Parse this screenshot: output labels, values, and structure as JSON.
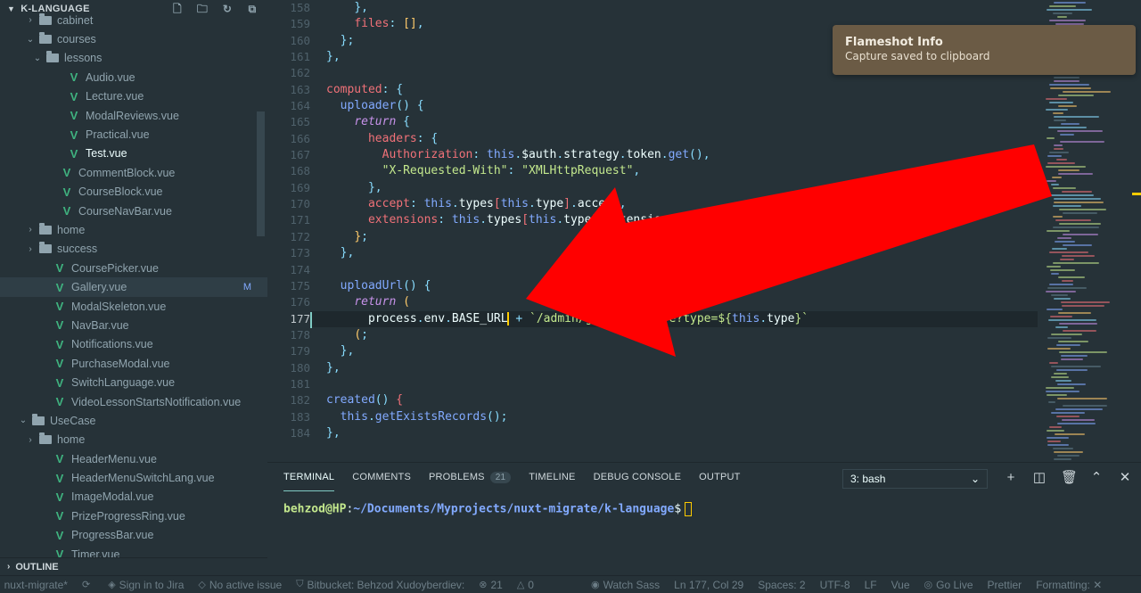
{
  "explorer": {
    "title": "K-LANGUAGE",
    "outline_label": "OUTLINE",
    "items": [
      {
        "label": "cabinet",
        "indent": 44,
        "type": "folder",
        "open": false
      },
      {
        "label": "courses",
        "indent": 44,
        "type": "folder",
        "open": true
      },
      {
        "label": "lessons",
        "indent": 52,
        "type": "folder",
        "open": true
      },
      {
        "label": "Audio.vue",
        "indent": 76,
        "type": "vue"
      },
      {
        "label": "Lecture.vue",
        "indent": 76,
        "type": "vue"
      },
      {
        "label": "ModalReviews.vue",
        "indent": 76,
        "type": "vue"
      },
      {
        "label": "Practical.vue",
        "indent": 76,
        "type": "vue"
      },
      {
        "label": "Test.vue",
        "indent": 76,
        "type": "vue",
        "active": true
      },
      {
        "label": "CommentBlock.vue",
        "indent": 68,
        "type": "vue"
      },
      {
        "label": "CourseBlock.vue",
        "indent": 68,
        "type": "vue"
      },
      {
        "label": "CourseNavBar.vue",
        "indent": 68,
        "type": "vue"
      },
      {
        "label": "home",
        "indent": 44,
        "type": "folder",
        "open": false
      },
      {
        "label": "success",
        "indent": 44,
        "type": "folder",
        "open": false
      },
      {
        "label": "CoursePicker.vue",
        "indent": 60,
        "type": "vue"
      },
      {
        "label": "Gallery.vue",
        "indent": 60,
        "type": "vue",
        "selected": true,
        "badge": "M"
      },
      {
        "label": "ModalSkeleton.vue",
        "indent": 60,
        "type": "vue"
      },
      {
        "label": "NavBar.vue",
        "indent": 60,
        "type": "vue"
      },
      {
        "label": "Notifications.vue",
        "indent": 60,
        "type": "vue"
      },
      {
        "label": "PurchaseModal.vue",
        "indent": 60,
        "type": "vue"
      },
      {
        "label": "SwitchLanguage.vue",
        "indent": 60,
        "type": "vue"
      },
      {
        "label": "VideoLessonStartsNotification.vue",
        "indent": 60,
        "type": "vue"
      },
      {
        "label": "UseCase",
        "indent": 36,
        "type": "folder",
        "open": true
      },
      {
        "label": "home",
        "indent": 44,
        "type": "folder",
        "open": false
      },
      {
        "label": "HeaderMenu.vue",
        "indent": 60,
        "type": "vue"
      },
      {
        "label": "HeaderMenuSwitchLang.vue",
        "indent": 60,
        "type": "vue"
      },
      {
        "label": "ImageModal.vue",
        "indent": 60,
        "type": "vue"
      },
      {
        "label": "PrizeProgressRing.vue",
        "indent": 60,
        "type": "vue"
      },
      {
        "label": "ProgressBar.vue",
        "indent": 60,
        "type": "vue"
      },
      {
        "label": "Timer.vue",
        "indent": 60,
        "type": "vue"
      }
    ]
  },
  "editor": {
    "current_line": "177",
    "lines": [
      {
        "n": "158",
        "indent": "    ",
        "tokens": [
          [
            "}",
            "p"
          ],
          [
            ",",
            "p"
          ]
        ]
      },
      {
        "n": "159",
        "indent": "    ",
        "tokens": [
          [
            "files",
            "pr"
          ],
          [
            ": ",
            "p"
          ],
          [
            "[]",
            "b"
          ],
          [
            ",",
            "p"
          ]
        ]
      },
      {
        "n": "160",
        "indent": "  ",
        "tokens": [
          [
            "}",
            "p"
          ],
          [
            ";",
            "p"
          ]
        ]
      },
      {
        "n": "161",
        "indent": "",
        "tokens": [
          [
            "}",
            "p"
          ],
          [
            ",",
            "p"
          ]
        ]
      },
      {
        "n": "162",
        "indent": "",
        "tokens": []
      },
      {
        "n": "163",
        "indent": "",
        "tokens": [
          [
            "computed",
            "pr"
          ],
          [
            ": ",
            "p"
          ],
          [
            "{",
            "p"
          ]
        ]
      },
      {
        "n": "164",
        "indent": "  ",
        "tokens": [
          [
            "uploader",
            "f"
          ],
          [
            "() ",
            "p"
          ],
          [
            "{",
            "p"
          ]
        ]
      },
      {
        "n": "165",
        "indent": "    ",
        "tokens": [
          [
            "return",
            "i"
          ],
          [
            " {",
            "p"
          ]
        ]
      },
      {
        "n": "166",
        "indent": "      ",
        "tokens": [
          [
            "headers",
            "pr"
          ],
          [
            ": ",
            "p"
          ],
          [
            "{",
            "p"
          ]
        ]
      },
      {
        "n": "167",
        "indent": "        ",
        "tokens": [
          [
            "Authorization",
            "pr"
          ],
          [
            ": ",
            "p"
          ],
          [
            "this",
            "f"
          ],
          [
            ".",
            "p"
          ],
          [
            "$auth",
            "v"
          ],
          [
            ".",
            "p"
          ],
          [
            "strategy",
            "v"
          ],
          [
            ".",
            "p"
          ],
          [
            "token",
            "v"
          ],
          [
            ".",
            "p"
          ],
          [
            "get",
            "f"
          ],
          [
            "(),",
            "p"
          ]
        ]
      },
      {
        "n": "168",
        "indent": "        ",
        "tokens": [
          [
            "\"X-Requested-With\"",
            "s"
          ],
          [
            ": ",
            "p"
          ],
          [
            "\"XMLHttpRequest\"",
            "s"
          ],
          [
            ",",
            "p"
          ]
        ]
      },
      {
        "n": "169",
        "indent": "      ",
        "tokens": [
          [
            "}",
            "p"
          ],
          [
            ",",
            "p"
          ]
        ]
      },
      {
        "n": "170",
        "indent": "      ",
        "tokens": [
          [
            "accept",
            "pr"
          ],
          [
            ": ",
            "p"
          ],
          [
            "this",
            "f"
          ],
          [
            ".",
            "p"
          ],
          [
            "types",
            "v"
          ],
          [
            "[",
            "pr"
          ],
          [
            "this",
            "f"
          ],
          [
            ".",
            "p"
          ],
          [
            "type",
            "v"
          ],
          [
            "]",
            "pr"
          ],
          [
            ".",
            "p"
          ],
          [
            "accept",
            "v"
          ],
          [
            ",",
            "p"
          ]
        ]
      },
      {
        "n": "171",
        "indent": "      ",
        "tokens": [
          [
            "extensions",
            "pr"
          ],
          [
            ": ",
            "p"
          ],
          [
            "this",
            "f"
          ],
          [
            ".",
            "p"
          ],
          [
            "types",
            "v"
          ],
          [
            "[",
            "pr"
          ],
          [
            "this",
            "f"
          ],
          [
            ".",
            "p"
          ],
          [
            "type",
            "v"
          ],
          [
            "]",
            "pr"
          ],
          [
            ".",
            "p"
          ],
          [
            "extensions",
            "v"
          ]
        ]
      },
      {
        "n": "172",
        "indent": "    ",
        "tokens": [
          [
            "}",
            "b"
          ],
          [
            ";",
            "p"
          ]
        ]
      },
      {
        "n": "173",
        "indent": "  ",
        "tokens": [
          [
            "}",
            "p"
          ],
          [
            ",",
            "p"
          ]
        ]
      },
      {
        "n": "174",
        "indent": "",
        "tokens": []
      },
      {
        "n": "175",
        "indent": "  ",
        "tokens": [
          [
            "uploadUrl",
            "f"
          ],
          [
            "() ",
            "p"
          ],
          [
            "{",
            "p"
          ]
        ]
      },
      {
        "n": "176",
        "indent": "    ",
        "tokens": [
          [
            "return",
            "i"
          ],
          [
            " ",
            "p"
          ],
          [
            "(",
            "b"
          ]
        ]
      },
      {
        "n": "177",
        "indent": "      ",
        "tokens": [
          [
            "process",
            "v"
          ],
          [
            ".",
            "p"
          ],
          [
            "env",
            "v"
          ],
          [
            ".",
            "p"
          ],
          [
            "BASE_URL",
            "v"
          ],
          [
            "|caret|",
            "caret"
          ],
          [
            " + ",
            "p"
          ],
          [
            "`/admin/gallery/store?type=${",
            "s"
          ],
          [
            "this",
            "f"
          ],
          [
            ".",
            "p"
          ],
          [
            "type",
            "v"
          ],
          [
            "}`",
            "s"
          ]
        ]
      },
      {
        "n": "178",
        "indent": "    ",
        "tokens": [
          [
            "(",
            "b"
          ],
          [
            ";",
            "p"
          ]
        ]
      },
      {
        "n": "179",
        "indent": "  ",
        "tokens": [
          [
            "}",
            "p"
          ],
          [
            ",",
            "p"
          ]
        ]
      },
      {
        "n": "180",
        "indent": "",
        "tokens": [
          [
            "}",
            "p"
          ],
          [
            ",",
            "p"
          ]
        ]
      },
      {
        "n": "181",
        "indent": "",
        "tokens": []
      },
      {
        "n": "182",
        "indent": "",
        "tokens": [
          [
            "created",
            "f"
          ],
          [
            "() ",
            "p"
          ],
          [
            "{",
            "pr"
          ]
        ]
      },
      {
        "n": "183",
        "indent": "  ",
        "tokens": [
          [
            "this",
            "f"
          ],
          [
            ".",
            "p"
          ],
          [
            "getExistsRecords",
            "f"
          ],
          [
            "();",
            "p"
          ]
        ]
      },
      {
        "n": "184",
        "indent": "",
        "tokens": [
          [
            "}",
            "p"
          ],
          [
            ",",
            "p"
          ]
        ]
      }
    ]
  },
  "notification": {
    "title": "Flameshot Info",
    "message": "Capture saved to clipboard"
  },
  "panel": {
    "tabs": [
      {
        "label": "TERMINAL",
        "active": true
      },
      {
        "label": "COMMENTS"
      },
      {
        "label": "PROBLEMS",
        "badge": "21"
      },
      {
        "label": "TIMELINE"
      },
      {
        "label": "DEBUG CONSOLE"
      },
      {
        "label": "OUTPUT"
      }
    ],
    "shell_selected": "3: bash",
    "actions": [
      "plus-icon",
      "split-icon",
      "trash-icon",
      "chevron-up-icon",
      "close-icon"
    ],
    "terminal": {
      "user": "behzod@HP",
      "sep": ":",
      "path": "~/Documents/Myprojects/nuxt-migrate/k-language",
      "prompt": "$"
    }
  },
  "statusbar": {
    "items": [
      {
        "icon": "branch-icon",
        "label": "nuxt-migrate*"
      },
      {
        "icon": "sync-icon",
        "label": ""
      },
      {
        "icon": "jira-icon",
        "label": "Sign in to Jira"
      },
      {
        "icon": "issue-icon",
        "label": "No active issue"
      },
      {
        "icon": "bitbucket-icon",
        "label": "Bitbucket: Behzod Xudoyberdiev:"
      },
      {
        "icon": "error-icon",
        "label": "21"
      },
      {
        "icon": "warning-icon",
        "label": "0"
      },
      {
        "icon": "eye-icon",
        "label": "Watch Sass"
      },
      {
        "icon": "",
        "label": "Ln 177, Col 29"
      },
      {
        "icon": "",
        "label": "Spaces: 2"
      },
      {
        "icon": "",
        "label": "UTF-8"
      },
      {
        "icon": "",
        "label": "LF"
      },
      {
        "icon": "",
        "label": "Vue"
      },
      {
        "icon": "broadcast-icon",
        "label": "Go Live"
      },
      {
        "icon": "",
        "label": "Prettier"
      },
      {
        "icon": "",
        "label": "Formatting: ✕"
      }
    ]
  },
  "colors": {
    "background": "#263238",
    "vue_icon": "#3fb27f",
    "cursor": "#ffcc00",
    "arrow": "#ff0000",
    "notification": "#6b5b45"
  }
}
